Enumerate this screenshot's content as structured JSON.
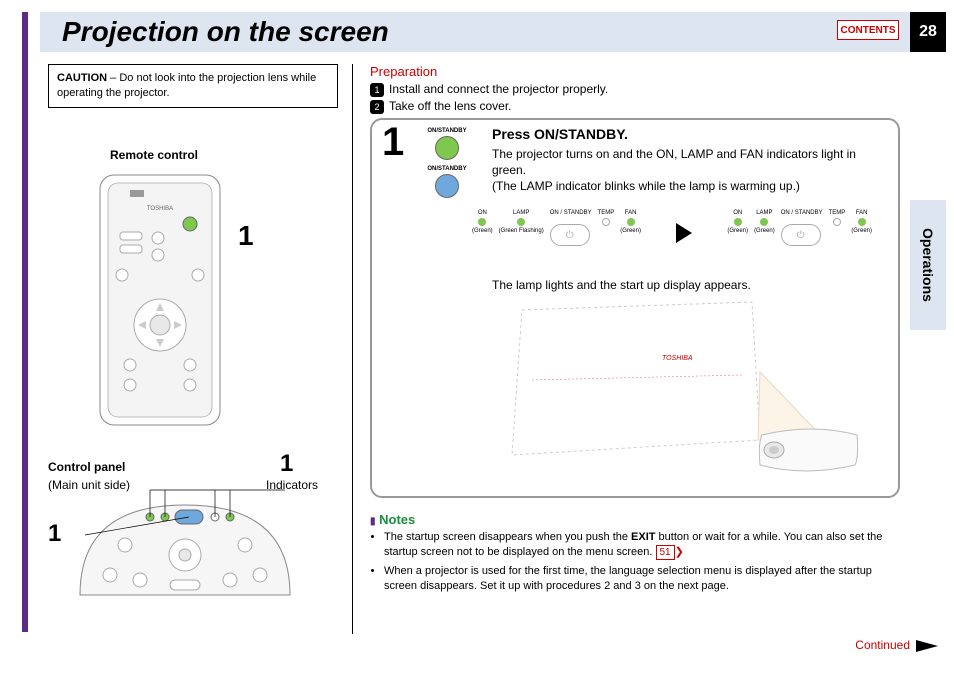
{
  "page_title": "Projection on the screen",
  "page_number": "28",
  "contents_label": "CONTENTS",
  "side_tab": "Operations",
  "caution": {
    "label": "CAUTION",
    "text": " – Do not look into the projection lens while operating the projector."
  },
  "remote_label": "Remote control",
  "remote_brand": "TOSHIBA",
  "control_panel_label": "Control panel",
  "control_panel_sub": "(Main unit side)",
  "indicators_label": "Indicators",
  "callout_num": "1",
  "preparation": {
    "heading": "Preparation",
    "items": [
      "Install and connect the projector properly.",
      "Take off the lens cover."
    ]
  },
  "step": {
    "num": "1",
    "btn_top_label": "ON/STANDBY",
    "btn_bottom_label": "ON/STANDBY",
    "title": "Press ON/STANDBY.",
    "text1": "The projector turns on and the ON, LAMP and FAN indicators light in green.",
    "text2": "(The LAMP indicator blinks while the lamp is warming up.)",
    "indicators": {
      "on": "ON",
      "lamp": "LAMP",
      "standby": "ON / STANDBY",
      "temp": "TEMP",
      "fan": "FAN",
      "green": "(Green)",
      "green_flash": "(Green Flashing)"
    },
    "lamp_line": "The lamp lights and the start up display appears."
  },
  "notes": {
    "heading": "Notes",
    "items": [
      {
        "pre": "The startup screen disappears when you push the ",
        "bold": "EXIT",
        "post": " button or wait for a while. You can also set the startup screen not to be displayed on the menu screen. ",
        "pageref": "51"
      },
      {
        "text": "When a projector is used for the first time, the language selection menu is displayed after the startup screen disappears. Set it up with procedures 2 and 3 on the next page."
      }
    ]
  },
  "continued": "Continued"
}
